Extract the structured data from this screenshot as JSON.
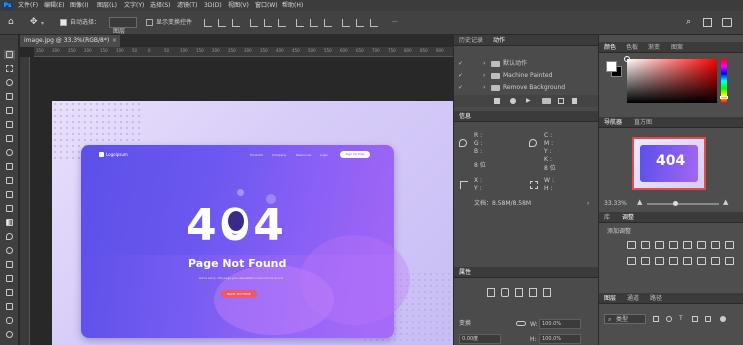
{
  "menubar": {
    "logo": "Ps",
    "items": [
      "文件(F)",
      "编辑(E)",
      "图像(I)",
      "图层(L)",
      "文字(Y)",
      "选择(S)",
      "滤镜(T)",
      "3D(D)",
      "视图(V)",
      "窗口(W)",
      "帮助(H)"
    ]
  },
  "options": {
    "auto_select_label": "自动选择：",
    "auto_select_value": "图层",
    "show_transform_label": "显示变换控件"
  },
  "document": {
    "tab_title": "image.jpg @ 33.3%(RGB/8*)",
    "ruler_marks": [
      "350",
      "300",
      "250",
      "200",
      "150",
      "100",
      "50",
      "0",
      "50",
      "100",
      "150",
      "200",
      "250",
      "300",
      "350",
      "400",
      "450",
      "500",
      "550",
      "600",
      "650",
      "700",
      "750",
      "800",
      "850",
      "900"
    ],
    "canvas": {
      "logo_text": "Logoipsum",
      "nav": [
        "Products",
        "Company",
        "Resources",
        "Login"
      ],
      "signup": "Sign Up Free",
      "error_code": "404",
      "headline": "Page Not Found",
      "subtext": "we're sorry, the page you requested could not be found",
      "cta": "BACK TO HOME"
    }
  },
  "actions_panel": {
    "tabs": [
      "历史记录",
      "动作"
    ],
    "active_tab": "动作",
    "rows": [
      "默认动作",
      "Machine Painted",
      "Remove Background"
    ]
  },
  "info_panel": {
    "tab": "信息",
    "labels": {
      "r": "R :",
      "g": "G :",
      "b": "B :",
      "c": "C :",
      "m": "M :",
      "y": "Y :",
      "k": "K :",
      "x": "X :",
      "yy": "Y :",
      "w": "W :",
      "h": "H :"
    },
    "bits_left": "8 位",
    "bits_right": "8 位",
    "doc_size": "文档：8.58M/8.58M"
  },
  "properties_panel": {
    "tab": "属性",
    "transform_label": "变换",
    "w_label": "W:",
    "w_value": "100.0%",
    "h_label": "H:",
    "h_value": "100.0%",
    "angle_value": "0.00度"
  },
  "color_panel": {
    "tabs": [
      "颜色",
      "色板",
      "渐变",
      "图案"
    ],
    "foreground": "#ffffff",
    "background": "#000000"
  },
  "navigator_panel": {
    "tabs": [
      "导航器",
      "直方图"
    ],
    "zoom": "33.33%"
  },
  "adjustments_panel": {
    "tabs": [
      "库",
      "调整"
    ],
    "active_tab": "调整",
    "add_label": "添加调整"
  },
  "layers_panel": {
    "tabs": [
      "图层",
      "通道",
      "路径"
    ],
    "filter_label": "类型"
  },
  "colors": {
    "accent": "#31a8ff",
    "page_purple": "#6c58f0",
    "cta_red": "#f0566c"
  }
}
